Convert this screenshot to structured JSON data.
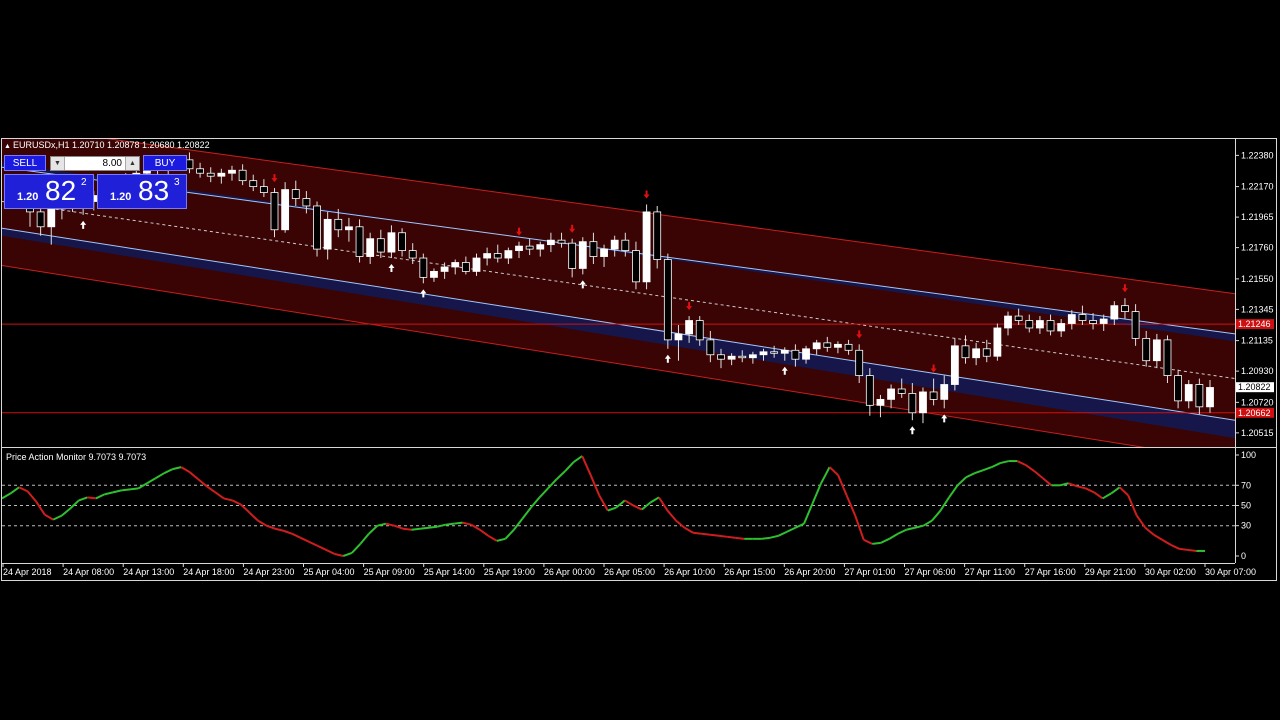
{
  "header": {
    "symbol_info": "EURUSDx,H1  1.20710 1.20878 1.20680 1.20822"
  },
  "trade_panel": {
    "sell_label": "SELL",
    "buy_label": "BUY",
    "lot_value": "8.00",
    "sell_price": {
      "prefix": "1.20",
      "big": "82",
      "sup": "2"
    },
    "buy_price": {
      "prefix": "1.20",
      "big": "83",
      "sup": "3"
    }
  },
  "indicator": {
    "label": "Price Action Monitor 9.7073 9.7073"
  },
  "colors": {
    "bull_candle": "#ffffff",
    "bear_candle": "#000000",
    "wick": "#e0e0e0",
    "channel_fill": "#3a0404",
    "channel_band": "#16164a",
    "channel_edge": "#c81e1e",
    "level_line": "#d01010",
    "indicator_up": "#2ec02e",
    "indicator_down": "#d01e1e",
    "up_arrow": "#ffffff",
    "down_arrow": "#e01010"
  },
  "chart_data": {
    "type": "candlestick",
    "price_axis": {
      "ticks": [
        "1.22380",
        "1.22170",
        "1.21965",
        "1.21760",
        "1.21550",
        "1.21345",
        "1.21135",
        "1.20930",
        "1.20720",
        "1.20515"
      ],
      "range": [
        1.2042,
        1.2249
      ]
    },
    "time_axis": {
      "labels": [
        "24 Apr 2018",
        "24 Apr 08:00",
        "24 Apr 13:00",
        "24 Apr 18:00",
        "24 Apr 23:00",
        "25 Apr 04:00",
        "25 Apr 09:00",
        "25 Apr 14:00",
        "25 Apr 19:00",
        "26 Apr 00:00",
        "26 Apr 05:00",
        "26 Apr 10:00",
        "26 Apr 15:00",
        "26 Apr 20:00",
        "27 Apr 01:00",
        "27 Apr 06:00",
        "27 Apr 11:00",
        "27 Apr 16:00",
        "29 Apr 21:00",
        "30 Apr 02:00",
        "30 Apr 07:00"
      ]
    },
    "current_price": "1.20822",
    "levels": [
      {
        "price": 1.21246,
        "label": "1.21246",
        "color": "#d01010"
      },
      {
        "price": 1.2065,
        "label": "1.20662",
        "color": "#d01010"
      }
    ],
    "channel": {
      "upper_outer": [
        1.2259,
        1.2145
      ],
      "upper_inner": [
        1.2233,
        1.2113
      ],
      "upper_band": [
        1.223,
        1.2118
      ],
      "mid": [
        1.2207,
        1.2088
      ],
      "lower_band": [
        1.2189,
        1.206
      ],
      "lower_inner": [
        1.2184,
        1.2048
      ],
      "lower_outer": [
        1.2164,
        1.2032
      ]
    },
    "candles": [
      [
        1.2204,
        1.2215,
        1.219,
        1.22
      ],
      [
        1.22,
        1.2206,
        1.2184,
        1.219
      ],
      [
        1.219,
        1.2205,
        1.2178,
        1.2202
      ],
      [
        1.2202,
        1.2212,
        1.2195,
        1.2208
      ],
      [
        1.2208,
        1.2214,
        1.22,
        1.2205
      ],
      [
        1.2205,
        1.2212,
        1.2198,
        1.2207
      ],
      [
        1.2207,
        1.2214,
        1.2201,
        1.2211
      ],
      [
        1.2211,
        1.2218,
        1.2205,
        1.2215
      ],
      [
        1.2215,
        1.2222,
        1.2209,
        1.2218
      ],
      [
        1.2218,
        1.2226,
        1.2212,
        1.2222
      ],
      [
        1.2222,
        1.2229,
        1.2216,
        1.2226
      ],
      [
        1.2226,
        1.2232,
        1.222,
        1.2228
      ],
      [
        1.2228,
        1.2234,
        1.2223,
        1.223
      ],
      [
        1.223,
        1.2235,
        1.2225,
        1.2232
      ],
      [
        1.2232,
        1.2238,
        1.2228,
        1.2235
      ],
      [
        1.2235,
        1.224,
        1.2226,
        1.2229
      ],
      [
        1.2229,
        1.2233,
        1.2223,
        1.2226
      ],
      [
        1.2226,
        1.223,
        1.222,
        1.2224
      ],
      [
        1.2224,
        1.2229,
        1.2219,
        1.2226
      ],
      [
        1.2226,
        1.2231,
        1.2221,
        1.2228
      ],
      [
        1.2228,
        1.2232,
        1.2218,
        1.2221
      ],
      [
        1.2221,
        1.2225,
        1.2214,
        1.2217
      ],
      [
        1.2217,
        1.2222,
        1.221,
        1.2213
      ],
      [
        1.2213,
        1.2216,
        1.2183,
        1.2188
      ],
      [
        1.2188,
        1.222,
        1.2186,
        1.2215
      ],
      [
        1.2215,
        1.2221,
        1.2204,
        1.2209
      ],
      [
        1.2209,
        1.2214,
        1.2199,
        1.2204
      ],
      [
        1.2204,
        1.2207,
        1.217,
        1.2175
      ],
      [
        1.2175,
        1.22,
        1.2168,
        1.2195
      ],
      [
        1.2195,
        1.2202,
        1.2183,
        1.2188
      ],
      [
        1.2188,
        1.2196,
        1.218,
        1.219
      ],
      [
        1.219,
        1.2195,
        1.2166,
        1.217
      ],
      [
        1.217,
        1.2186,
        1.2165,
        1.2182
      ],
      [
        1.2182,
        1.2188,
        1.2169,
        1.2173
      ],
      [
        1.2173,
        1.2191,
        1.2169,
        1.2186
      ],
      [
        1.2186,
        1.2189,
        1.217,
        1.2174
      ],
      [
        1.2174,
        1.2179,
        1.2165,
        1.2169
      ],
      [
        1.2169,
        1.2172,
        1.2152,
        1.2156
      ],
      [
        1.2156,
        1.2162,
        1.2153,
        1.216
      ],
      [
        1.216,
        1.2166,
        1.2155,
        1.2163
      ],
      [
        1.2163,
        1.2168,
        1.2158,
        1.2166
      ],
      [
        1.2166,
        1.217,
        1.2158,
        1.216
      ],
      [
        1.216,
        1.2172,
        1.2157,
        1.2169
      ],
      [
        1.2169,
        1.2176,
        1.2164,
        1.2172
      ],
      [
        1.2172,
        1.2178,
        1.2166,
        1.2169
      ],
      [
        1.2169,
        1.2176,
        1.2165,
        1.2174
      ],
      [
        1.2174,
        1.218,
        1.2169,
        1.2177
      ],
      [
        1.2177,
        1.2182,
        1.2171,
        1.2175
      ],
      [
        1.2175,
        1.218,
        1.217,
        1.2178
      ],
      [
        1.2178,
        1.2186,
        1.2173,
        1.2181
      ],
      [
        1.2181,
        1.2186,
        1.2176,
        1.2179
      ],
      [
        1.2179,
        1.2182,
        1.2156,
        1.2162
      ],
      [
        1.2162,
        1.2183,
        1.2158,
        1.218
      ],
      [
        1.218,
        1.2186,
        1.2165,
        1.217
      ],
      [
        1.217,
        1.2178,
        1.2163,
        1.2175
      ],
      [
        1.2175,
        1.2184,
        1.217,
        1.2181
      ],
      [
        1.2181,
        1.2186,
        1.217,
        1.2174
      ],
      [
        1.2174,
        1.218,
        1.2148,
        1.2153
      ],
      [
        1.2153,
        1.2205,
        1.2148,
        1.22
      ],
      [
        1.22,
        1.2204,
        1.2162,
        1.2168
      ],
      [
        1.2168,
        1.2172,
        1.2108,
        1.2114
      ],
      [
        1.2114,
        1.2124,
        1.21,
        1.2118
      ],
      [
        1.2118,
        1.213,
        1.2112,
        1.2127
      ],
      [
        1.2127,
        1.213,
        1.211,
        1.2114
      ],
      [
        1.2114,
        1.212,
        1.2099,
        1.2104
      ],
      [
        1.2104,
        1.2108,
        1.2095,
        1.2101
      ],
      [
        1.2101,
        1.2105,
        1.2097,
        1.2103
      ],
      [
        1.2103,
        1.2107,
        1.2099,
        1.2102
      ],
      [
        1.2102,
        1.2106,
        1.2098,
        1.2104
      ],
      [
        1.2104,
        1.2108,
        1.21,
        1.2106
      ],
      [
        1.2106,
        1.211,
        1.2102,
        1.2105
      ],
      [
        1.2105,
        1.2109,
        1.21,
        1.2107
      ],
      [
        1.2107,
        1.2111,
        1.2096,
        1.2101
      ],
      [
        1.2101,
        1.211,
        1.2098,
        1.2108
      ],
      [
        1.2108,
        1.2114,
        1.2104,
        1.2112
      ],
      [
        1.2112,
        1.2116,
        1.2106,
        1.2109
      ],
      [
        1.2109,
        1.2113,
        1.2105,
        1.2111
      ],
      [
        1.2111,
        1.2114,
        1.2104,
        1.2107
      ],
      [
        1.2107,
        1.2111,
        1.2085,
        1.209
      ],
      [
        1.209,
        1.2095,
        1.2063,
        1.207
      ],
      [
        1.207,
        1.2077,
        1.2062,
        1.2074
      ],
      [
        1.2074,
        1.2084,
        1.2068,
        1.2081
      ],
      [
        1.2081,
        1.2088,
        1.2075,
        1.2078
      ],
      [
        1.2078,
        1.2085,
        1.206,
        1.2065
      ],
      [
        1.2065,
        1.2082,
        1.2058,
        1.2079
      ],
      [
        1.2079,
        1.2088,
        1.207,
        1.2074
      ],
      [
        1.2074,
        1.209,
        1.2068,
        1.2084
      ],
      [
        1.2084,
        1.2115,
        1.208,
        1.211
      ],
      [
        1.211,
        1.2117,
        1.2098,
        1.2102
      ],
      [
        1.2102,
        1.2112,
        1.2097,
        1.2108
      ],
      [
        1.2108,
        1.2114,
        1.2099,
        1.2103
      ],
      [
        1.2103,
        1.2125,
        1.21,
        1.2122
      ],
      [
        1.2122,
        1.2133,
        1.2117,
        1.213
      ],
      [
        1.213,
        1.2135,
        1.2124,
        1.2127
      ],
      [
        1.2127,
        1.2131,
        1.2119,
        1.2122
      ],
      [
        1.2122,
        1.213,
        1.2118,
        1.2127
      ],
      [
        1.2127,
        1.2131,
        1.2117,
        1.212
      ],
      [
        1.212,
        1.2128,
        1.2116,
        1.2125
      ],
      [
        1.2125,
        1.2134,
        1.2121,
        1.2131
      ],
      [
        1.2131,
        1.2137,
        1.2124,
        1.2127
      ],
      [
        1.2127,
        1.2132,
        1.2121,
        1.2125
      ],
      [
        1.2125,
        1.2131,
        1.212,
        1.2128
      ],
      [
        1.2128,
        1.214,
        1.2124,
        1.2137
      ],
      [
        1.2137,
        1.2142,
        1.2128,
        1.2133
      ],
      [
        1.2133,
        1.2138,
        1.211,
        1.2115
      ],
      [
        1.2115,
        1.212,
        1.2096,
        1.21
      ],
      [
        1.21,
        1.2118,
        1.2095,
        1.2114
      ],
      [
        1.2114,
        1.2117,
        1.2085,
        1.209
      ],
      [
        1.209,
        1.2094,
        1.2068,
        1.2073
      ],
      [
        1.2073,
        1.2087,
        1.2068,
        1.2084
      ],
      [
        1.2084,
        1.2088,
        1.2064,
        1.2069
      ],
      [
        1.2069,
        1.2087,
        1.2065,
        1.2082
      ]
    ],
    "signals": [
      {
        "i": 5,
        "type": "up"
      },
      {
        "i": 23,
        "type": "down"
      },
      {
        "i": 46,
        "type": "down"
      },
      {
        "i": 51,
        "type": "down"
      },
      {
        "i": 34,
        "type": "up"
      },
      {
        "i": 37,
        "type": "up"
      },
      {
        "i": 52,
        "type": "up"
      },
      {
        "i": 58,
        "type": "down"
      },
      {
        "i": 60,
        "type": "up"
      },
      {
        "i": 62,
        "type": "down"
      },
      {
        "i": 71,
        "type": "up"
      },
      {
        "i": 78,
        "type": "down"
      },
      {
        "i": 83,
        "type": "up"
      },
      {
        "i": 85,
        "type": "down"
      },
      {
        "i": 86,
        "type": "up"
      },
      {
        "i": 103,
        "type": "down"
      }
    ],
    "indicator": {
      "ticks": [
        "100",
        "70",
        "50",
        "30",
        "0"
      ],
      "range": [
        0,
        100
      ],
      "levels": [
        70,
        50,
        30
      ],
      "values": [
        57,
        62,
        68,
        64,
        54,
        41,
        36,
        40,
        47,
        55,
        58,
        57,
        61,
        63,
        65,
        66,
        67,
        72,
        77,
        82,
        86,
        88,
        83,
        76,
        69,
        63,
        57,
        55,
        51,
        43,
        35,
        30,
        27,
        25,
        22,
        18,
        14,
        10,
        6,
        2,
        0,
        3,
        12,
        22,
        30,
        32,
        30,
        27,
        26,
        27,
        28,
        29,
        31,
        32,
        33,
        31,
        26,
        20,
        15,
        17,
        26,
        37,
        48,
        58,
        67,
        76,
        84,
        93,
        99,
        80,
        60,
        45,
        48,
        55,
        50,
        46,
        53,
        58,
        45,
        35,
        28,
        23,
        22,
        21,
        20,
        19,
        18,
        17,
        17,
        17,
        18,
        20,
        24,
        28,
        32,
        52,
        72,
        88,
        80,
        60,
        40,
        16,
        12,
        13,
        17,
        22,
        26,
        28,
        30,
        35,
        45,
        58,
        70,
        78,
        82,
        85,
        88,
        92,
        94,
        94,
        90,
        84,
        77,
        70,
        70,
        72,
        69,
        67,
        63,
        57,
        62,
        68,
        60,
        40,
        28,
        21,
        16,
        11,
        7,
        6,
        5,
        5
      ]
    }
  }
}
